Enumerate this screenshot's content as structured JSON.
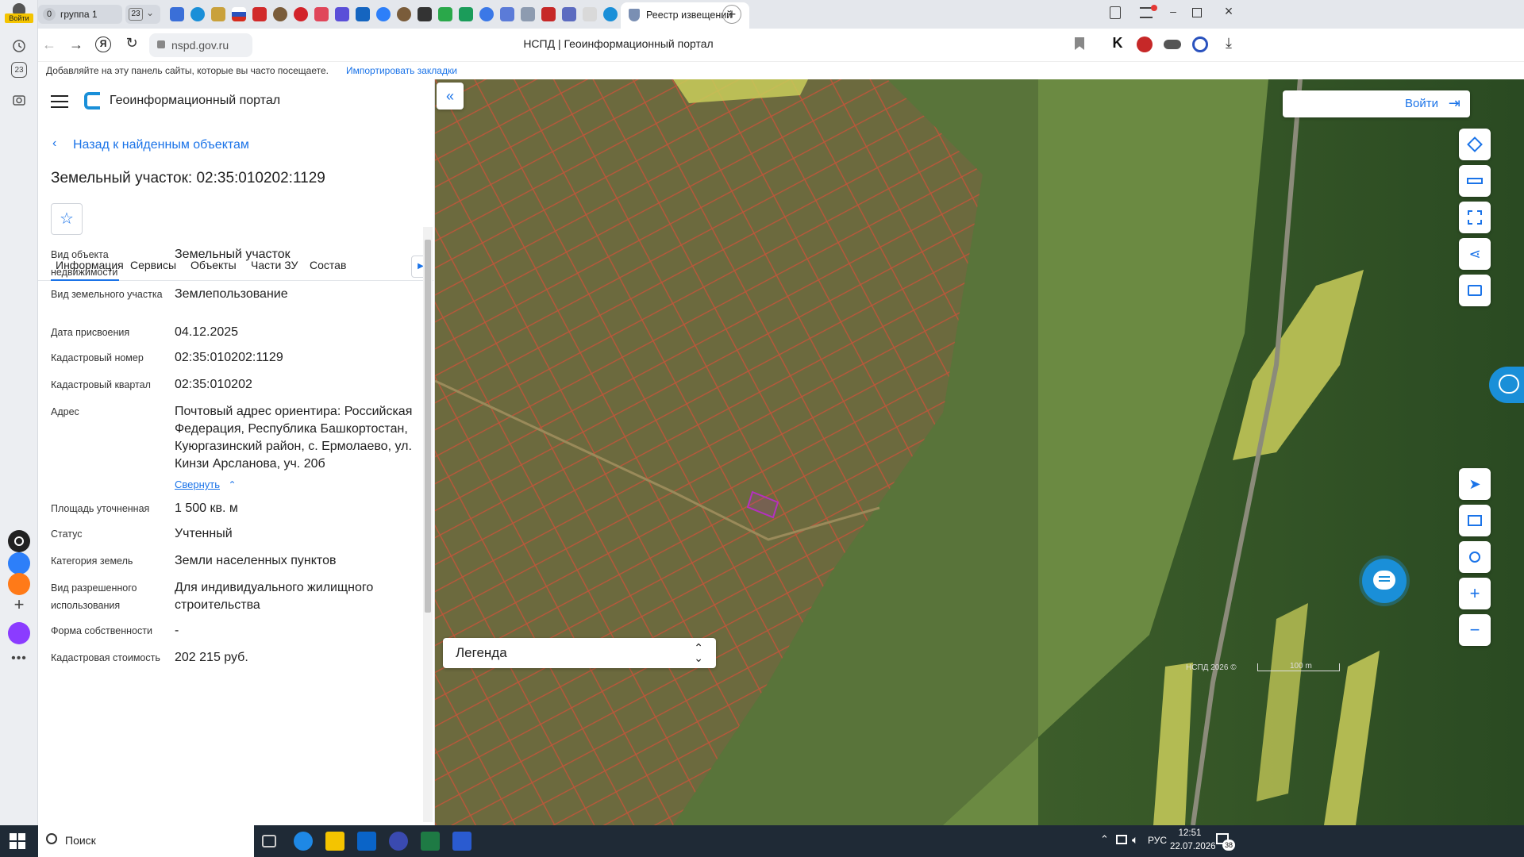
{
  "browser": {
    "tab_group_count": "0",
    "tab_group_label": "группа 1",
    "tab_count_badge": "23",
    "active_tab_title": "Реестр извещений",
    "url": "nspd.gov.ru",
    "page_title": "НСПД | Геоинформационный портал",
    "bookmarks_hint": "Добавляйте на эту панель сайты, которые вы часто посещаете.",
    "bookmarks_import": "Импортировать закладки",
    "profile_label": "Войти",
    "rail_badge": "23"
  },
  "portal": {
    "title": "Геоинформационный портал",
    "back_label": "Назад к найденным объектам",
    "object_title": "Земельный участок: 02:35:010202:1129",
    "tabs": [
      {
        "label": "Информация",
        "active": true
      },
      {
        "label": "Сервисы",
        "active": false
      },
      {
        "label": "Объекты",
        "active": false
      },
      {
        "label": "Части ЗУ",
        "active": false
      },
      {
        "label": "Состав",
        "active": false
      }
    ],
    "attributes": [
      {
        "label": "Вид объекта недвижимости",
        "value": "Земельный участок"
      },
      {
        "label": "Вид земельного участка",
        "value": "Землепользование"
      },
      {
        "label": "Дата присвоения",
        "value": "04.12.2025"
      },
      {
        "label": "Кадастровый номер",
        "value": "02:35:010202:1129"
      },
      {
        "label": "Кадастровый квартал",
        "value": "02:35:010202"
      },
      {
        "label": "Адрес",
        "value": "Почтовый адрес ориентира: Российская Федерация, Республика Башкортостан, Куюргазинский район, с. Ермолаево, ул. Кинзи Арсланова, уч. 20б"
      },
      {
        "label": "Площадь уточненная",
        "value": "1 500 кв. м"
      },
      {
        "label": "Статус",
        "value": "Учтенный"
      },
      {
        "label": "Категория земель",
        "value": "Земли населенных пунктов"
      },
      {
        "label": "Вид разрешенного использования",
        "value": "Для индивидуального жилищного строительства"
      },
      {
        "label": "Форма собственности",
        "value": "-"
      },
      {
        "label": "Кадастровая стоимость",
        "value": "202 215 руб."
      }
    ],
    "collapse_label": "Свернуть"
  },
  "map": {
    "login_label": "Войти",
    "legend_label": "Легенда",
    "attribution": "НСПД 2026 ©",
    "scale_label": "100 m",
    "colors": {
      "parcel_stroke": "#c0553a",
      "selected_parcel": "#b530c0",
      "accent": "#1a73e8",
      "field": "#c9cc5a"
    }
  },
  "taskbar": {
    "search_placeholder": "Поиск",
    "language": "РУС",
    "time": "12:51",
    "date": "22.07.2026",
    "notifications": "38"
  }
}
